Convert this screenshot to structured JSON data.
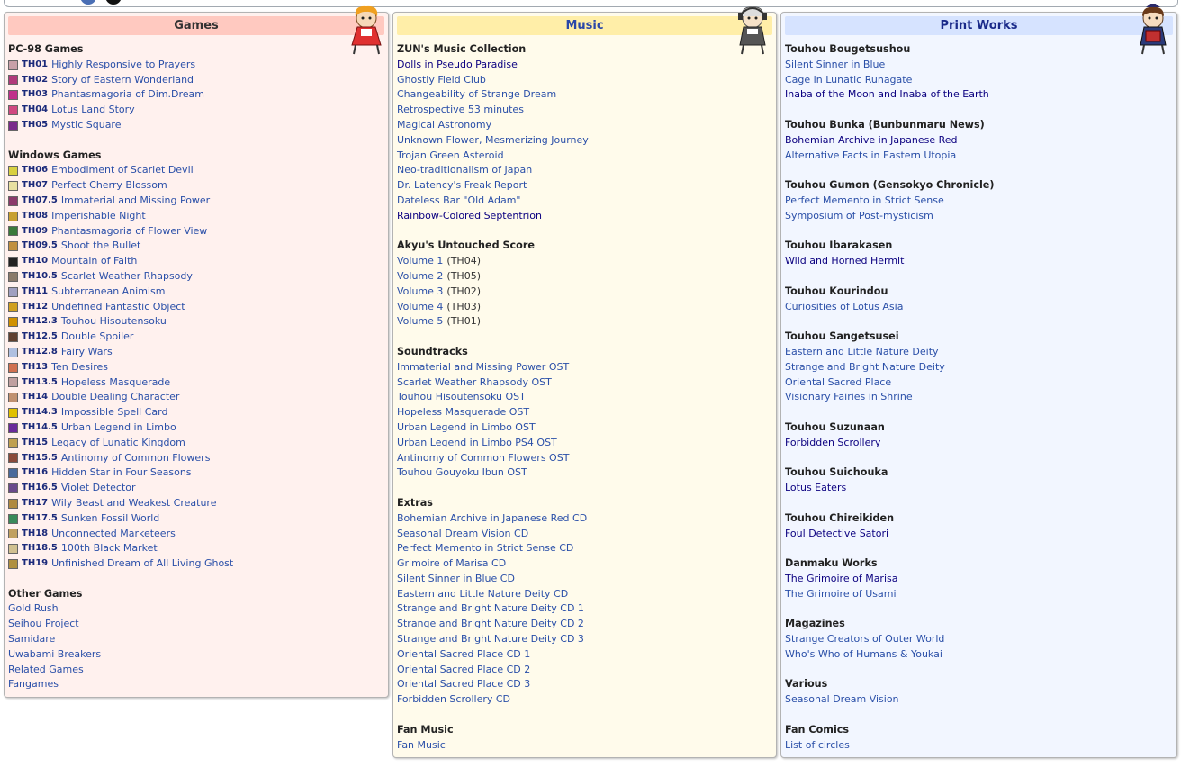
{
  "games": {
    "title": "Games",
    "sections": [
      {
        "title": "PC-98 Games",
        "items": [
          {
            "code": "TH01",
            "label": "Highly Responsive to Prayers",
            "icon_color": "#c8a0a8"
          },
          {
            "code": "TH02",
            "label": "Story of Eastern Wonderland",
            "icon_color": "#b03a7a"
          },
          {
            "code": "TH03",
            "label": "Phantasmagoria of Dim.Dream",
            "icon_color": "#c0308a"
          },
          {
            "code": "TH04",
            "label": "Lotus Land Story",
            "icon_color": "#d04880"
          },
          {
            "code": "TH05",
            "label": "Mystic Square",
            "icon_color": "#7a2a8a"
          }
        ]
      },
      {
        "title": "Windows Games",
        "items": [
          {
            "code": "TH06",
            "label": "Embodiment of Scarlet Devil",
            "icon_color": "#d8d040"
          },
          {
            "code": "TH07",
            "label": "Perfect Cherry Blossom",
            "icon_color": "#e8e0a0"
          },
          {
            "code": "TH07.5",
            "label": "Immaterial and Missing Power",
            "icon_color": "#8a3a6a"
          },
          {
            "code": "TH08",
            "label": "Imperishable Night",
            "icon_color": "#c8a030"
          },
          {
            "code": "TH09",
            "label": "Phantasmagoria of Flower View",
            "icon_color": "#3a7a3a"
          },
          {
            "code": "TH09.5",
            "label": "Shoot the Bullet",
            "icon_color": "#c09040"
          },
          {
            "code": "TH10",
            "label": "Mountain of Faith",
            "icon_color": "#222222"
          },
          {
            "code": "TH10.5",
            "label": "Scarlet Weather Rhapsody",
            "icon_color": "#8a7a6a"
          },
          {
            "code": "TH11",
            "label": "Subterranean Animism",
            "icon_color": "#a0a0c0"
          },
          {
            "code": "TH12",
            "label": "Undefined Fantastic Object",
            "icon_color": "#d0a020"
          },
          {
            "code": "TH12.3",
            "label": "Touhou Hisoutensoku",
            "icon_color": "#d09000"
          },
          {
            "code": "TH12.5",
            "label": "Double Spoiler",
            "icon_color": "#604030"
          },
          {
            "code": "TH12.8",
            "label": "Fairy Wars",
            "icon_color": "#b0c0e0"
          },
          {
            "code": "TH13",
            "label": "Ten Desires",
            "icon_color": "#d07050"
          },
          {
            "code": "TH13.5",
            "label": "Hopeless Masquerade",
            "icon_color": "#c0a0a0"
          },
          {
            "code": "TH14",
            "label": "Double Dealing Character",
            "icon_color": "#c09070"
          },
          {
            "code": "TH14.3",
            "label": "Impossible Spell Card",
            "icon_color": "#e0c000"
          },
          {
            "code": "TH14.5",
            "label": "Urban Legend in Limbo",
            "icon_color": "#6a2a9a"
          },
          {
            "code": "TH15",
            "label": "Legacy of Lunatic Kingdom",
            "icon_color": "#c0a050"
          },
          {
            "code": "TH15.5",
            "label": "Antinomy of Common Flowers",
            "icon_color": "#8a4a3a"
          },
          {
            "code": "TH16",
            "label": "Hidden Star in Four Seasons",
            "icon_color": "#4a6a9a"
          },
          {
            "code": "TH16.5",
            "label": "Violet Detector",
            "icon_color": "#6a4a8a"
          },
          {
            "code": "TH17",
            "label": "Wily Beast and Weakest Creature",
            "icon_color": "#b08a40"
          },
          {
            "code": "TH17.5",
            "label": "Sunken Fossil World",
            "icon_color": "#3a8a5a"
          },
          {
            "code": "TH18",
            "label": "Unconnected Marketeers",
            "icon_color": "#c0a060"
          },
          {
            "code": "TH18.5",
            "label": "100th Black Market",
            "icon_color": "#d0c090"
          },
          {
            "code": "TH19",
            "label": "Unfinished Dream of All Living Ghost",
            "icon_color": "#b09040"
          }
        ]
      },
      {
        "title": "Other Games",
        "items": [
          {
            "label": "Gold Rush"
          },
          {
            "label": "Seihou Project"
          },
          {
            "label": "Samidare"
          },
          {
            "label": "Uwabami Breakers"
          },
          {
            "label": "Related Games"
          },
          {
            "label": "Fangames"
          }
        ]
      }
    ]
  },
  "music": {
    "title": "Music",
    "sections": [
      {
        "title": "ZUN's Music Collection",
        "items": [
          {
            "label": "Dolls in Pseudo Paradise",
            "visited": true
          },
          {
            "label": "Ghostly Field Club"
          },
          {
            "label": "Changeability of Strange Dream"
          },
          {
            "label": "Retrospective 53 minutes"
          },
          {
            "label": "Magical Astronomy"
          },
          {
            "label": "Unknown Flower, Mesmerizing Journey"
          },
          {
            "label": "Trojan Green Asteroid"
          },
          {
            "label": "Neo-traditionalism of Japan"
          },
          {
            "label": "Dr. Latency's Freak Report"
          },
          {
            "label": "Dateless Bar \"Old Adam\""
          },
          {
            "label": "Rainbow-Colored Septentrion",
            "visited": true
          }
        ]
      },
      {
        "title": "Akyu's Untouched Score",
        "items": [
          {
            "label": "Volume 1",
            "note": "(TH04)"
          },
          {
            "label": "Volume 2",
            "note": "(TH05)"
          },
          {
            "label": "Volume 3",
            "note": "(TH02)"
          },
          {
            "label": "Volume 4",
            "note": "(TH03)"
          },
          {
            "label": "Volume 5",
            "note": "(TH01)"
          }
        ]
      },
      {
        "title": "Soundtracks",
        "items": [
          {
            "label": "Immaterial and Missing Power OST"
          },
          {
            "label": "Scarlet Weather Rhapsody OST"
          },
          {
            "label": "Touhou Hisoutensoku OST"
          },
          {
            "label": "Hopeless Masquerade OST"
          },
          {
            "label": "Urban Legend in Limbo OST"
          },
          {
            "label": "Urban Legend in Limbo PS4 OST"
          },
          {
            "label": "Antinomy of Common Flowers OST"
          },
          {
            "label": "Touhou Gouyoku Ibun OST"
          }
        ]
      },
      {
        "title": "Extras",
        "items": [
          {
            "label": "Bohemian Archive in Japanese Red CD"
          },
          {
            "label": "Seasonal Dream Vision CD"
          },
          {
            "label": "Perfect Memento in Strict Sense CD"
          },
          {
            "label": "Grimoire of Marisa CD"
          },
          {
            "label": "Silent Sinner in Blue CD"
          },
          {
            "label": "Eastern and Little Nature Deity CD"
          },
          {
            "label": "Strange and Bright Nature Deity CD 1"
          },
          {
            "label": "Strange and Bright Nature Deity CD 2"
          },
          {
            "label": "Strange and Bright Nature Deity CD 3"
          },
          {
            "label": "Oriental Sacred Place CD 1"
          },
          {
            "label": "Oriental Sacred Place CD 2"
          },
          {
            "label": "Oriental Sacred Place CD 3"
          },
          {
            "label": "Forbidden Scrollery CD"
          }
        ]
      },
      {
        "title": "Fan Music",
        "items": [
          {
            "label": "Fan Music"
          }
        ]
      }
    ]
  },
  "print": {
    "title": "Print Works",
    "sections": [
      {
        "title": "Touhou Bougetsushou",
        "items": [
          {
            "label": "Silent Sinner in Blue"
          },
          {
            "label": "Cage in Lunatic Runagate"
          },
          {
            "label": "Inaba of the Moon and Inaba of the Earth",
            "visited": true
          }
        ]
      },
      {
        "title": "Touhou Bunka (Bunbunmaru News)",
        "items": [
          {
            "label": "Bohemian Archive in Japanese Red",
            "visited": true
          },
          {
            "label": "Alternative Facts in Eastern Utopia"
          }
        ]
      },
      {
        "title": "Touhou Gumon (Gensokyo Chronicle)",
        "items": [
          {
            "label": "Perfect Memento in Strict Sense"
          },
          {
            "label": "Symposium of Post-mysticism"
          }
        ]
      },
      {
        "title": "Touhou Ibarakasen",
        "items": [
          {
            "label": "Wild and Horned Hermit",
            "visited": true
          }
        ]
      },
      {
        "title": "Touhou Kourindou",
        "items": [
          {
            "label": "Curiosities of Lotus Asia"
          }
        ]
      },
      {
        "title": "Touhou Sangetsusei",
        "items": [
          {
            "label": "Eastern and Little Nature Deity"
          },
          {
            "label": "Strange and Bright Nature Deity"
          },
          {
            "label": "Oriental Sacred Place"
          },
          {
            "label": "Visionary Fairies in Shrine"
          }
        ]
      },
      {
        "title": "Touhou Suzunaan",
        "items": [
          {
            "label": "Forbidden Scrollery",
            "visited": true
          }
        ]
      },
      {
        "title": "Touhou Suichouka",
        "items": [
          {
            "label": "Lotus Eaters",
            "underline": true
          }
        ]
      },
      {
        "title": "Touhou Chireikiden",
        "items": [
          {
            "label": "Foul Detective Satori",
            "visited": true
          }
        ]
      },
      {
        "title": "Danmaku Works",
        "items": [
          {
            "label": "The Grimoire of Marisa",
            "visited": true
          },
          {
            "label": "The Grimoire of Usami"
          }
        ]
      },
      {
        "title": "Magazines",
        "items": [
          {
            "label": "Strange Creators of Outer World"
          },
          {
            "label": "Who's Who of Humans & Youkai"
          }
        ]
      },
      {
        "title": "Various",
        "items": [
          {
            "label": "Seasonal Dream Vision"
          }
        ]
      },
      {
        "title": "Fan Comics",
        "items": [
          {
            "label": "List of circles"
          }
        ]
      }
    ]
  }
}
